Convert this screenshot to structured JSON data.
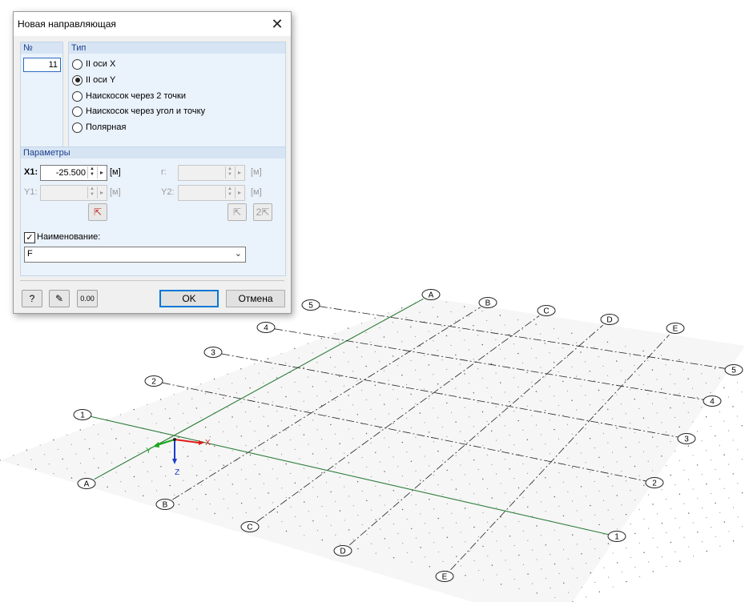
{
  "dialog": {
    "title": "Новая направляющая",
    "number_group": {
      "header": "№",
      "value": "11"
    },
    "type_group": {
      "header": "Тип",
      "options": [
        {
          "label": "II оси X",
          "selected": false
        },
        {
          "label": "II оси Y",
          "selected": true
        },
        {
          "label": "Наискосок через 2 точки",
          "selected": false
        },
        {
          "label": "Наискосок через угол и точку",
          "selected": false
        },
        {
          "label": "Полярная",
          "selected": false
        }
      ]
    },
    "params_group": {
      "header": "Параметры",
      "x1_label": "X1:",
      "x1_value": "-25.500",
      "x1_unit": "[м]",
      "y1_label": "Y1:",
      "y1_unit": "[м]",
      "r_label": "r:",
      "r_unit": "[м]",
      "y2_label": "Y2:",
      "y2_unit": "[м]"
    },
    "name": {
      "checkbox_label": "Наименование:",
      "checked": true,
      "value": "F"
    },
    "ok_label": "OK",
    "cancel_label": "Отмена"
  },
  "viewport": {
    "axes": {
      "x": "X",
      "y": "Y",
      "z": "Z"
    },
    "colors": {
      "x_axis": "#e11b1b",
      "y_axis": "#19a819",
      "z_axis": "#1a3dcc",
      "grid_dots": "#555555",
      "selected_line": "#2d7d3a"
    },
    "gridlines": {
      "letter_start": [
        "A",
        "B",
        "C",
        "D",
        "E"
      ],
      "letter_end": [
        "A",
        "B",
        "C",
        "D",
        "E"
      ],
      "number_start": [
        "1",
        "2",
        "3",
        "4",
        "5"
      ],
      "number_end": [
        "1",
        "2",
        "3",
        "4",
        "5"
      ]
    }
  }
}
